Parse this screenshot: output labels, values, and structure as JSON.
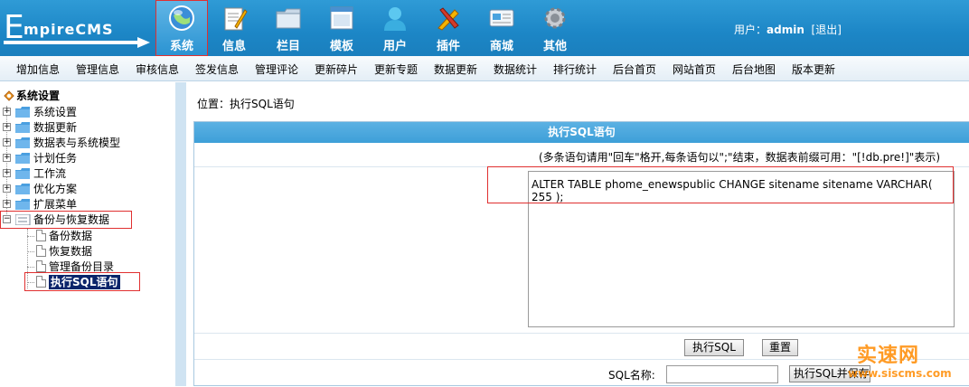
{
  "header": {
    "logo_initial": "E",
    "logo_rest": "mpireCMS",
    "nav": [
      {
        "label": "系统",
        "icon": "globe-icon"
      },
      {
        "label": "信息",
        "icon": "notepad-icon"
      },
      {
        "label": "栏目",
        "icon": "folder-icon"
      },
      {
        "label": "模板",
        "icon": "window-icon"
      },
      {
        "label": "用户",
        "icon": "user-icon"
      },
      {
        "label": "插件",
        "icon": "tools-icon"
      },
      {
        "label": "商城",
        "icon": "card-icon"
      },
      {
        "label": "其他",
        "icon": "gear-icon"
      }
    ],
    "user_prefix": "用户：",
    "username": "admin",
    "logout": "[退出]"
  },
  "submenu": [
    "增加信息",
    "管理信息",
    "审核信息",
    "签发信息",
    "管理评论",
    "更新碎片",
    "更新专题",
    "数据更新",
    "数据统计",
    "排行统计",
    "后台首页",
    "网站首页",
    "后台地图",
    "版本更新"
  ],
  "tree": {
    "root": "系统设置",
    "items": [
      "系统设置",
      "数据更新",
      "数据表与系统模型",
      "计划任务",
      "工作流",
      "优化方案",
      "扩展菜单",
      "备份与恢复数据"
    ],
    "children": [
      "备份数据",
      "恢复数据",
      "管理备份目录",
      "执行SQL语句"
    ]
  },
  "main": {
    "breadcrumb_label": "位置：",
    "breadcrumb_link": "执行SQL语句",
    "title": "执行SQL语句",
    "hint": "(多条语句请用\"回车\"格开,每条语句以\";\"结束，数据表前缀可用：\"[!db.pre!]\"表示)",
    "sql_value": "ALTER TABLE phome_enewspublic CHANGE sitename sitename VARCHAR( 255 );",
    "execute_button": "执行SQL",
    "reset_button": "重置",
    "sqlname_label": "SQL名称:",
    "save_button": "执行SQL并保存"
  },
  "watermark": {
    "title": "实速网",
    "url": "www.siscms.com"
  }
}
